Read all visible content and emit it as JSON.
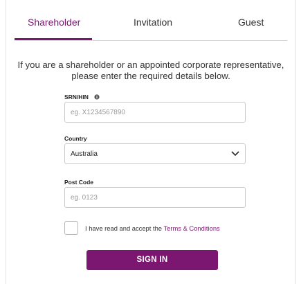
{
  "tabs": [
    {
      "label": "Shareholder",
      "active": true
    },
    {
      "label": "Invitation",
      "active": false
    },
    {
      "label": "Guest",
      "active": false
    }
  ],
  "intro": {
    "line1": "If you are a shareholder or an appointed corporate representative,",
    "line2": "please enter the required details below."
  },
  "form": {
    "srn": {
      "label": "SRN/HIN",
      "placeholder": "eg. X1234567890",
      "value": "",
      "icon": "info-icon"
    },
    "country": {
      "label": "Country",
      "value": "Australia",
      "icon": "chevron-down-icon"
    },
    "postcode": {
      "label": "Post Code",
      "placeholder": "eg. 0123",
      "value": ""
    },
    "terms": {
      "prefix": "I have read and accept the ",
      "link": "Terms & Conditions",
      "checked": false
    },
    "submit_label": "SIGN IN"
  },
  "colors": {
    "accent": "#7b1770",
    "border": "#c9c9c9",
    "text": "#333333"
  }
}
